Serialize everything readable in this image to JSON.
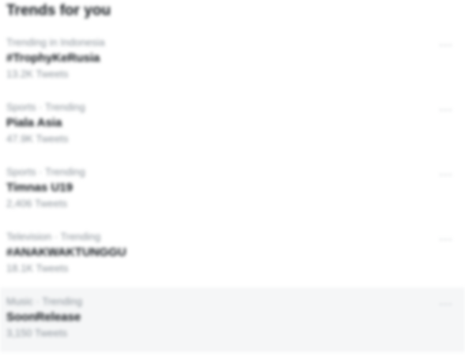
{
  "header": {
    "title": "Trends for you"
  },
  "trends": [
    {
      "context": "Trending in Indonesia",
      "name": "#TrophyKeRusia",
      "count": "13.2K Tweets",
      "more_icon": "more-horizontal-icon"
    },
    {
      "context": "Sports · Trending",
      "name": "Piala Asia",
      "count": "47.9K Tweets",
      "more_icon": "more-horizontal-icon"
    },
    {
      "context": "Sports · Trending",
      "name": "Timnas U19",
      "count": "2,406 Tweets",
      "more_icon": "more-horizontal-icon"
    },
    {
      "context": "Television · Trending",
      "name": "#ANAKWAKTUNGGU",
      "count": "18.1K Tweets",
      "more_icon": "more-horizontal-icon"
    },
    {
      "context": "Music · Trending",
      "name": "SoonRelease",
      "count": "3,150 Tweets",
      "more_icon": "more-horizontal-icon"
    }
  ]
}
